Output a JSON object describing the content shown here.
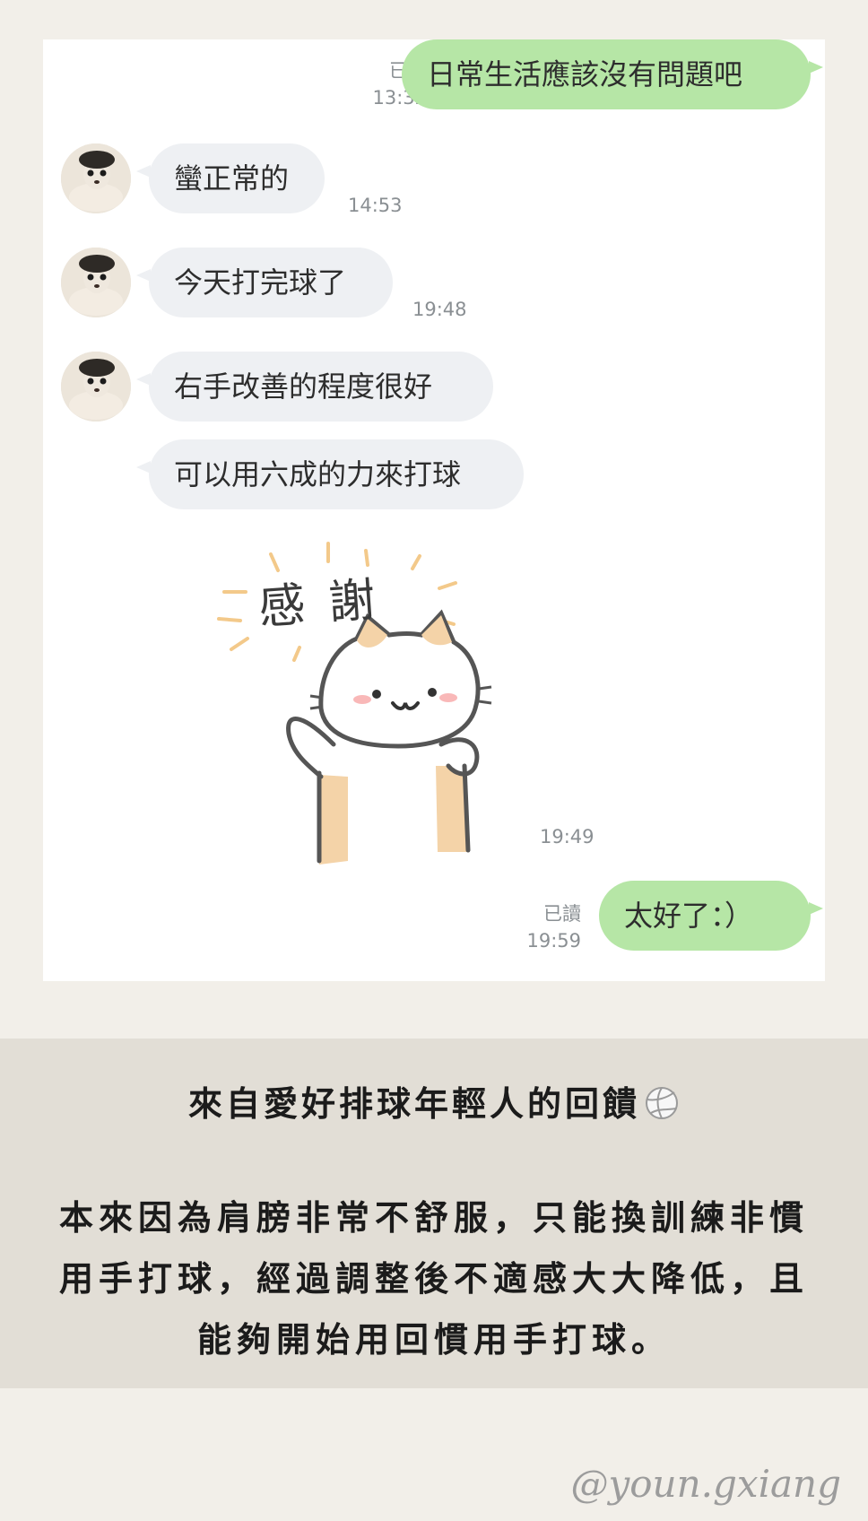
{
  "messages": [
    {
      "text": "日常生活應該沒有問題吧",
      "read": "已讀",
      "time": "13:32"
    },
    {
      "text": "蠻正常的",
      "time": "14:53"
    },
    {
      "text": "今天打完球了",
      "time": "19:48"
    },
    {
      "text": "右手改善的程度很好"
    },
    {
      "text": "可以用六成的力來打球"
    },
    {
      "sticker_text": "感謝",
      "time": "19:49"
    },
    {
      "text": "太好了：）",
      "read": "已讀",
      "time": "19:59"
    }
  ],
  "caption": {
    "title": "來自愛好排球年輕人的回饋",
    "title_icon": "volleyball-icon",
    "body": "本來因為肩膀非常不舒服，只能換訓練非慣用手打球，經過調整後不適感大大降低，且能夠開始用回慣用手打球。"
  },
  "watermark": "@youn.gxiang",
  "colors": {
    "background": "#f2efe9",
    "outgoing_bubble": "#b6e6a6",
    "incoming_bubble": "#eef0f3",
    "caption_band": "#e2ded6"
  }
}
